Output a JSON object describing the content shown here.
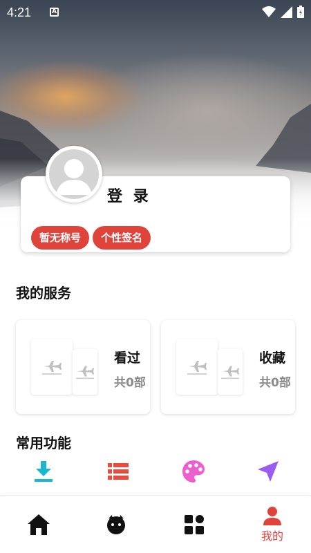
{
  "status_bar": {
    "time": "4:21",
    "a_badge": "A"
  },
  "profile": {
    "login_label": "登 录",
    "tags": [
      "暂无称号",
      "个性签名"
    ]
  },
  "services": {
    "title": "我的服务",
    "cards": [
      {
        "label": "看过",
        "count": "共0部"
      },
      {
        "label": "收藏",
        "count": "共0部"
      }
    ]
  },
  "functions": {
    "title": "常用功能",
    "items": [
      {
        "icon": "download-icon",
        "color": "#1bb7d1"
      },
      {
        "icon": "list-icon",
        "color": "#e94b3c"
      },
      {
        "icon": "palette-icon",
        "color": "#ec5fcf"
      },
      {
        "icon": "send-icon",
        "color": "#9b5cf0"
      }
    ]
  },
  "bottom_nav": {
    "items": [
      {
        "icon": "home-icon",
        "label": ""
      },
      {
        "icon": "face-icon",
        "label": ""
      },
      {
        "icon": "grid-icon",
        "label": ""
      },
      {
        "icon": "user-icon",
        "label": "我的",
        "active": true
      }
    ]
  },
  "colors": {
    "accent": "#e0433a",
    "active_nav": "#e0433a"
  }
}
